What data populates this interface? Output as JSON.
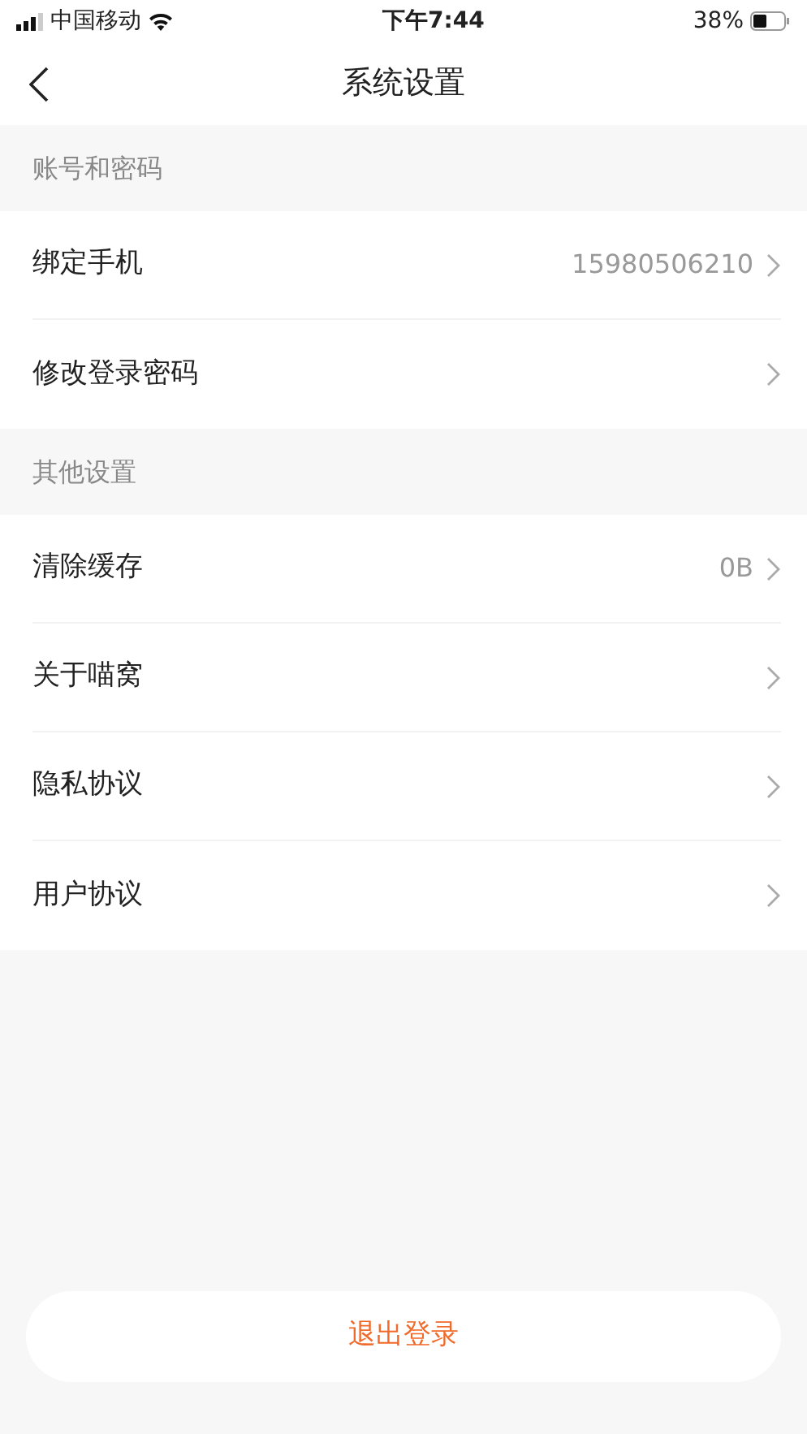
{
  "status_bar": {
    "carrier": "中国移动",
    "time": "下午7:44",
    "battery": "38%"
  },
  "nav": {
    "title": "系统设置"
  },
  "sections": [
    {
      "title": "账号和密码",
      "items": [
        {
          "label": "绑定手机",
          "value": "15980506210"
        },
        {
          "label": "修改登录密码"
        }
      ]
    },
    {
      "title": "其他设置",
      "items": [
        {
          "label": "清除缓存",
          "value": "0B"
        },
        {
          "label": "关于喵窝"
        },
        {
          "label": "隐私协议"
        },
        {
          "label": "用户协议"
        }
      ]
    }
  ],
  "logout_button": "退出登录"
}
